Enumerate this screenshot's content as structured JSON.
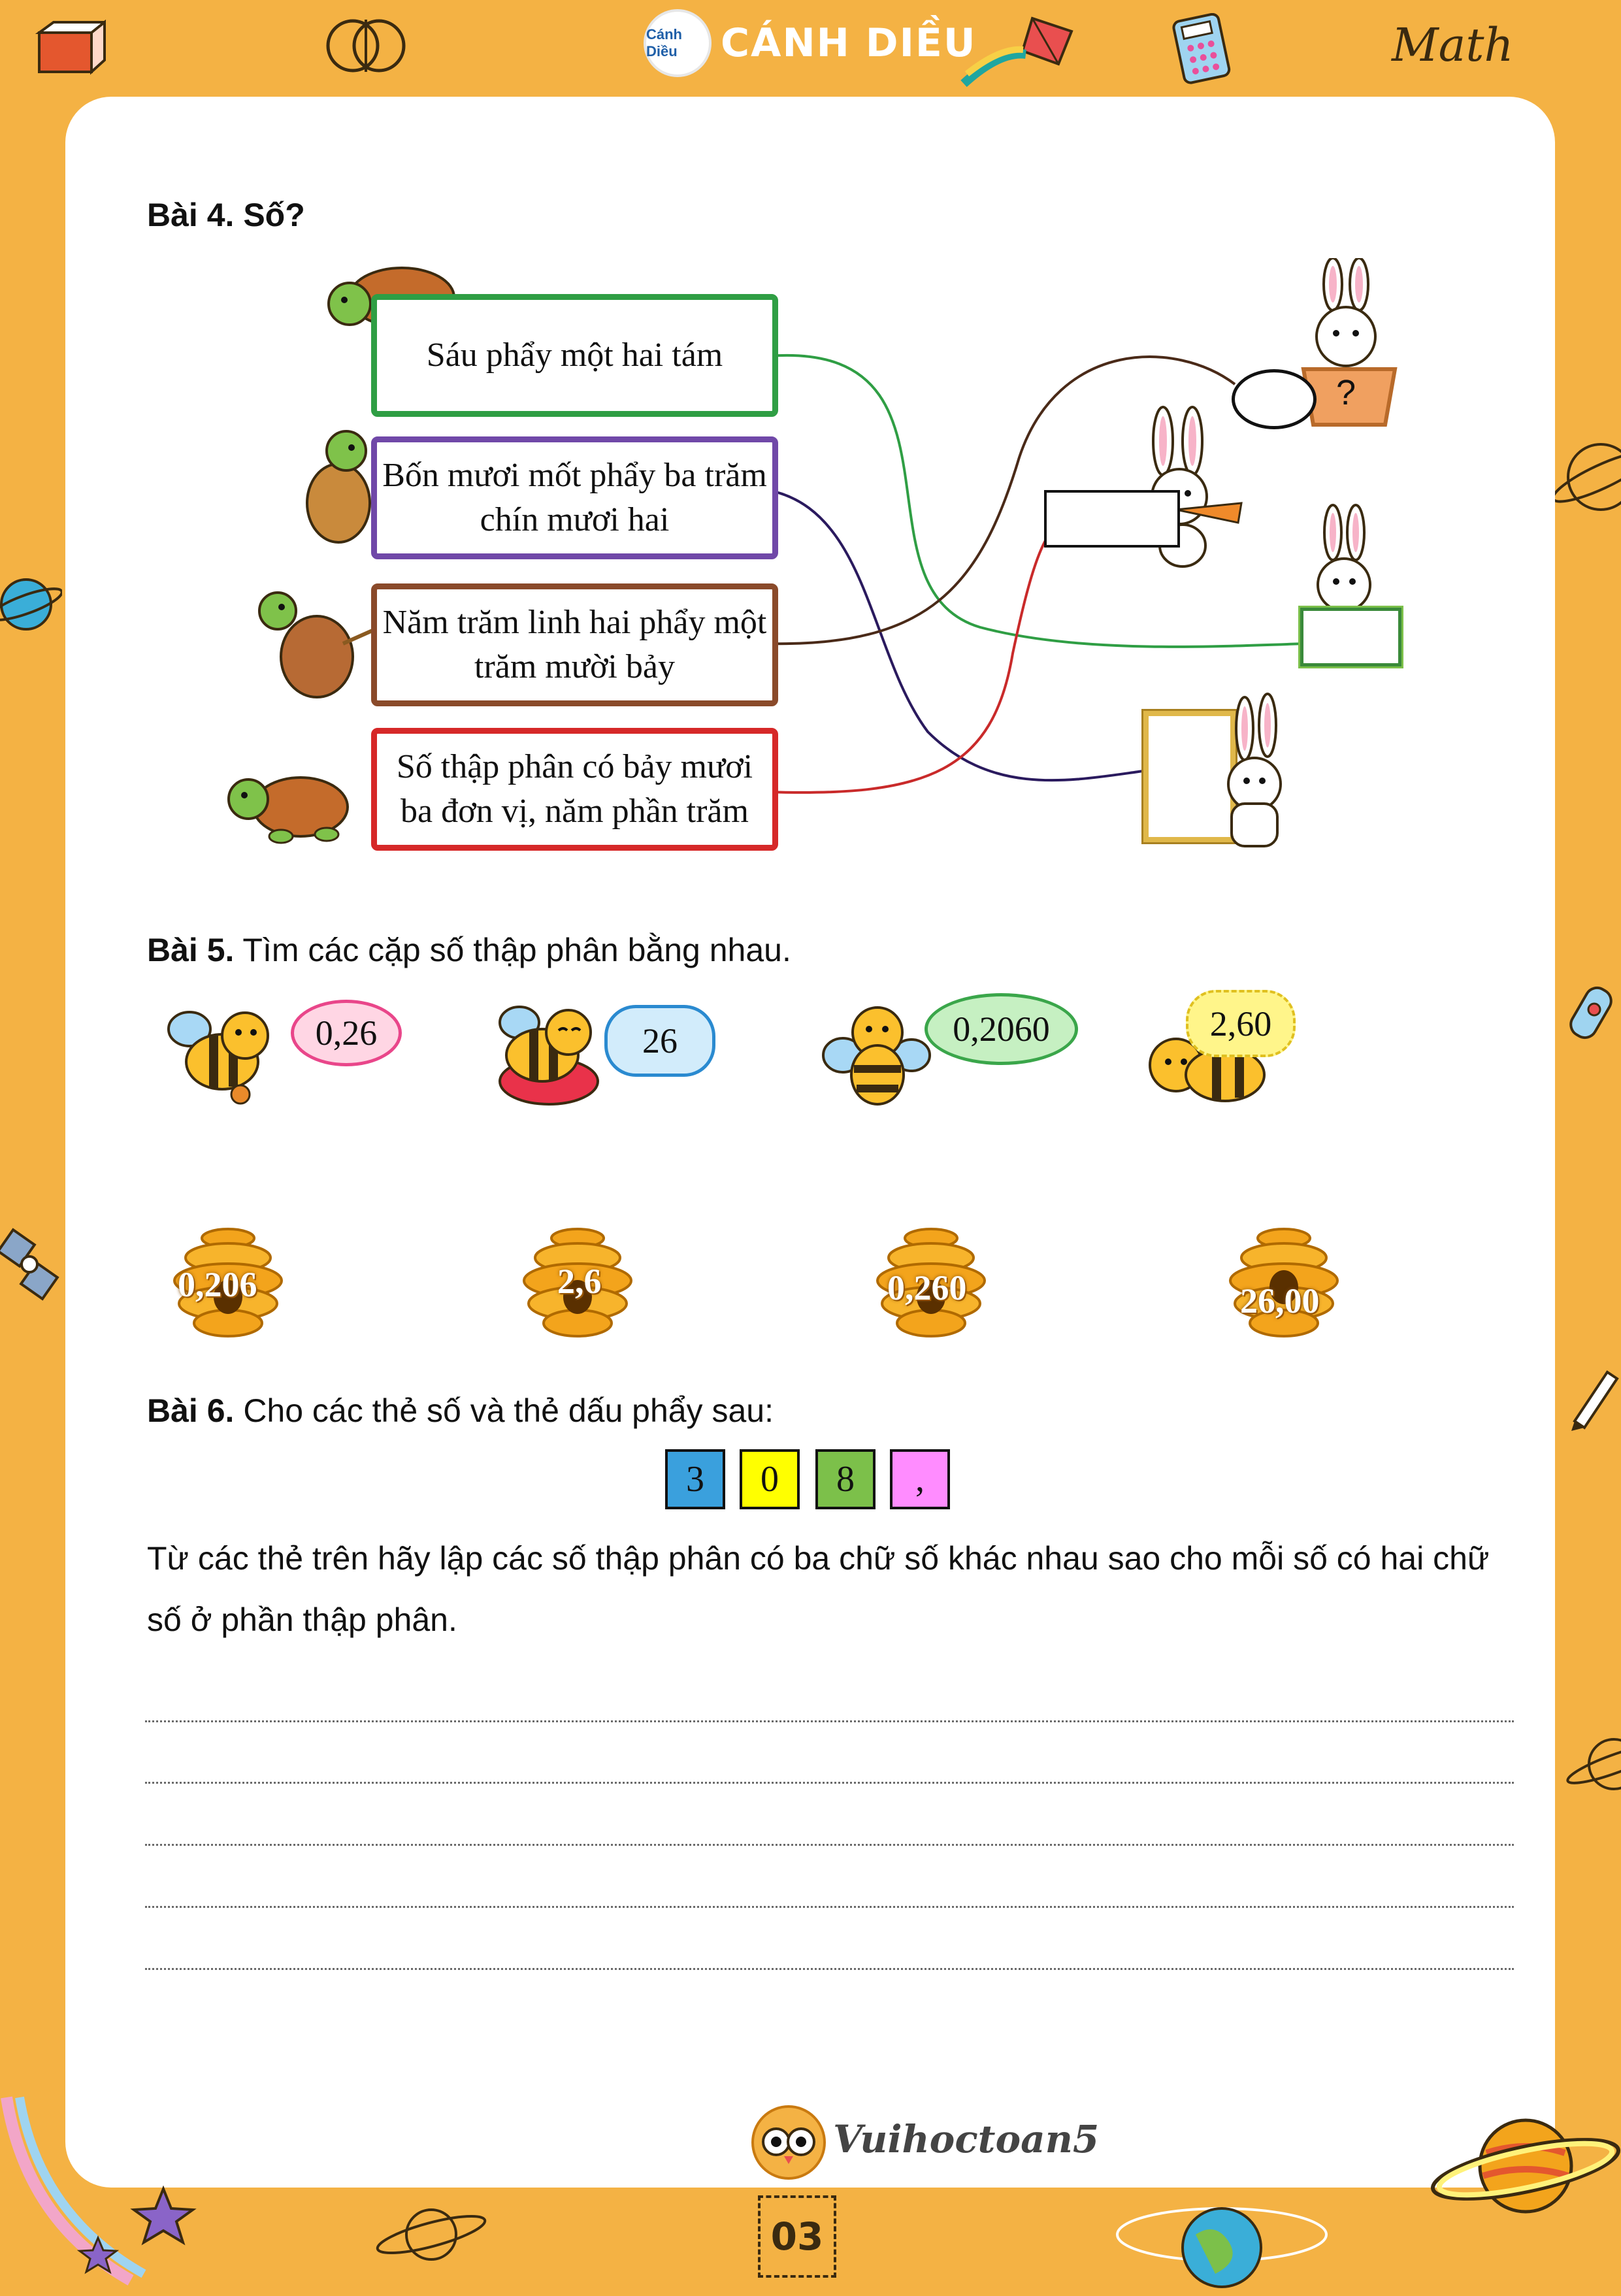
{
  "header": {
    "brand_logo_text": "Cánh Diều",
    "brand_title": "CÁNH DIỀU",
    "math_label": "Math"
  },
  "bai4": {
    "num": "Bài 4.",
    "title": "Số?",
    "boxes": [
      "Sáu phẩy một hai tám",
      "Bốn mươi mốt phẩy ba trăm chín mươi hai",
      "Năm trăm linh hai phẩy một trăm mười bảy",
      "Số thập phân có bảy mươi ba đơn vị, năm phần trăm"
    ],
    "basket_mark": "?"
  },
  "bai5": {
    "num": "Bài 5.",
    "title": "Tìm các cặp số thập phân bằng nhau.",
    "bees": [
      "0,26",
      "26",
      "0,2060",
      "2,60"
    ],
    "hives": [
      "0,206",
      "2,6",
      "0,260",
      "26,00"
    ]
  },
  "bai6": {
    "num": "Bài 6.",
    "title": "Cho các thẻ số và thẻ dấu phẩy sau:",
    "cards": [
      {
        "label": "3",
        "color": "#3aa0dd"
      },
      {
        "label": "0",
        "color": "#ffff00"
      },
      {
        "label": "8",
        "color": "#7cc04a"
      },
      {
        "label": ",",
        "color": "#ff8cff"
      }
    ],
    "instruction": "Từ các thẻ trên hãy lập các số thập phân có ba chữ số khác nhau sao cho mỗi số có hai chữ số ở phần thập phân."
  },
  "footer": {
    "brand": "Vuihoctoan5",
    "page_number": "03"
  }
}
